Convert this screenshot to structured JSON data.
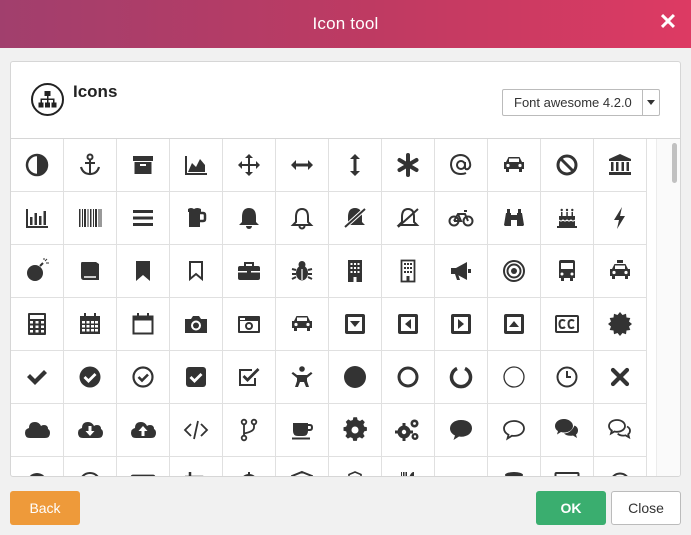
{
  "dialog": {
    "title": "Icon tool",
    "close_glyph": "✕"
  },
  "panel": {
    "heading": "Icons",
    "heading_icon": "sitemap-icon",
    "font_select": {
      "selected": "Font awesome 4.2.0"
    }
  },
  "icons": [
    [
      "adjust-icon",
      "anchor-icon",
      "archive-icon",
      "area-chart-icon",
      "arrows-icon",
      "arrows-h-icon",
      "arrows-v-icon",
      "asterisk-icon",
      "at-icon",
      "car-icon",
      "ban-icon",
      "bank-icon"
    ],
    [
      "bar-chart-icon",
      "barcode-icon",
      "bars-icon",
      "beer-icon",
      "bell-icon",
      "bell-o-icon",
      "bell-slash-icon",
      "bell-slash-o-icon",
      "bicycle-icon",
      "binoculars-icon",
      "birthday-cake-icon",
      "bolt-icon"
    ],
    [
      "bomb-icon",
      "book-icon",
      "bookmark-icon",
      "bookmark-o-icon",
      "briefcase-icon",
      "bug-icon",
      "building-icon",
      "building-o-icon",
      "bullhorn-icon",
      "bullseye-icon",
      "bus-icon",
      "taxi-icon"
    ],
    [
      "calculator-icon",
      "calendar-icon",
      "calendar-o-icon",
      "camera-icon",
      "camera-retro-icon",
      "car-icon",
      "caret-square-down-icon",
      "caret-square-left-icon",
      "caret-square-right-icon",
      "caret-square-up-icon",
      "cc-icon",
      "certificate-icon"
    ],
    [
      "check-icon",
      "check-circle-icon",
      "check-circle-o-icon",
      "check-square-icon",
      "check-square-o-icon",
      "child-icon",
      "circle-icon",
      "circle-o-icon",
      "circle-o-notch-icon",
      "circle-thin-icon",
      "clock-o-icon",
      "close-icon"
    ],
    [
      "cloud-icon",
      "cloud-download-icon",
      "cloud-upload-icon",
      "code-icon",
      "code-fork-icon",
      "coffee-icon",
      "cog-icon",
      "cogs-icon",
      "comment-icon",
      "comment-o-icon",
      "comments-icon",
      "comments-o-icon"
    ],
    [
      "compass-icon",
      "copyright-icon",
      "credit-card-icon",
      "crop-icon",
      "crosshairs-icon",
      "cube-icon",
      "cubes-icon",
      "cutlery-icon",
      "dashboard-icon",
      "database-icon",
      "desktop-icon",
      "dot-circle-icon"
    ]
  ],
  "buttons": {
    "back": "Back",
    "ok": "OK",
    "close": "Close"
  },
  "colors": {
    "title_gradient_start": "#a13f6d",
    "title_gradient_end": "#dd3a63",
    "back": "#ee9a3a",
    "ok": "#3aae6f",
    "icon": "#333333"
  }
}
